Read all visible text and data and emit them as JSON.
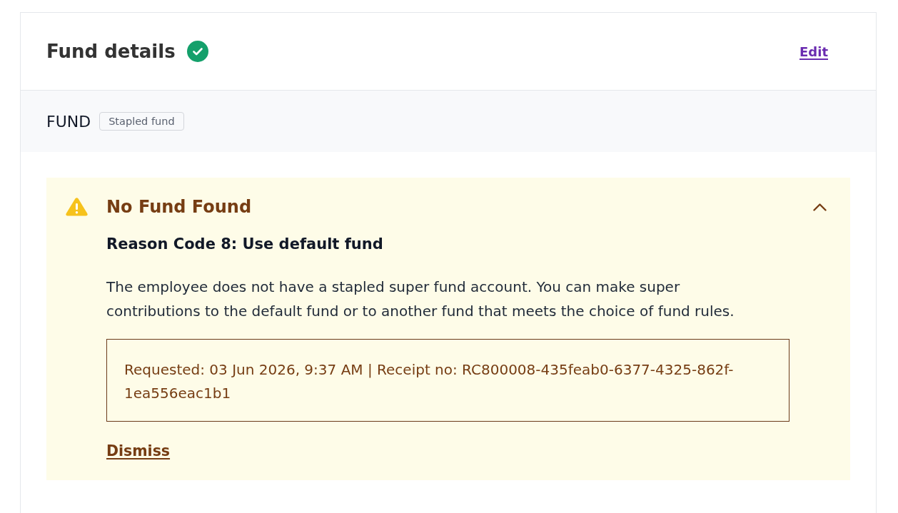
{
  "card": {
    "title": "Fund details",
    "complete": true,
    "edit_link": "Edit"
  },
  "fund_section": {
    "label": "FUND",
    "badge": "Stapled fund"
  },
  "alert": {
    "kind": "warning",
    "title": "No Fund Found",
    "expanded": true,
    "subtitle": "Reason Code 8: Use default fund",
    "message": "The employee does not have a stapled super fund account. You can make super contributions to the default fund or to another fund that meets the choice of fund rules.",
    "receipt": "Requested: 03 Jun 2026, 9:37 AM | Receipt no: RC800008-435feab0-6377-4325-862f-1ea556eac1b1",
    "dismiss_link": "Dismiss"
  }
}
